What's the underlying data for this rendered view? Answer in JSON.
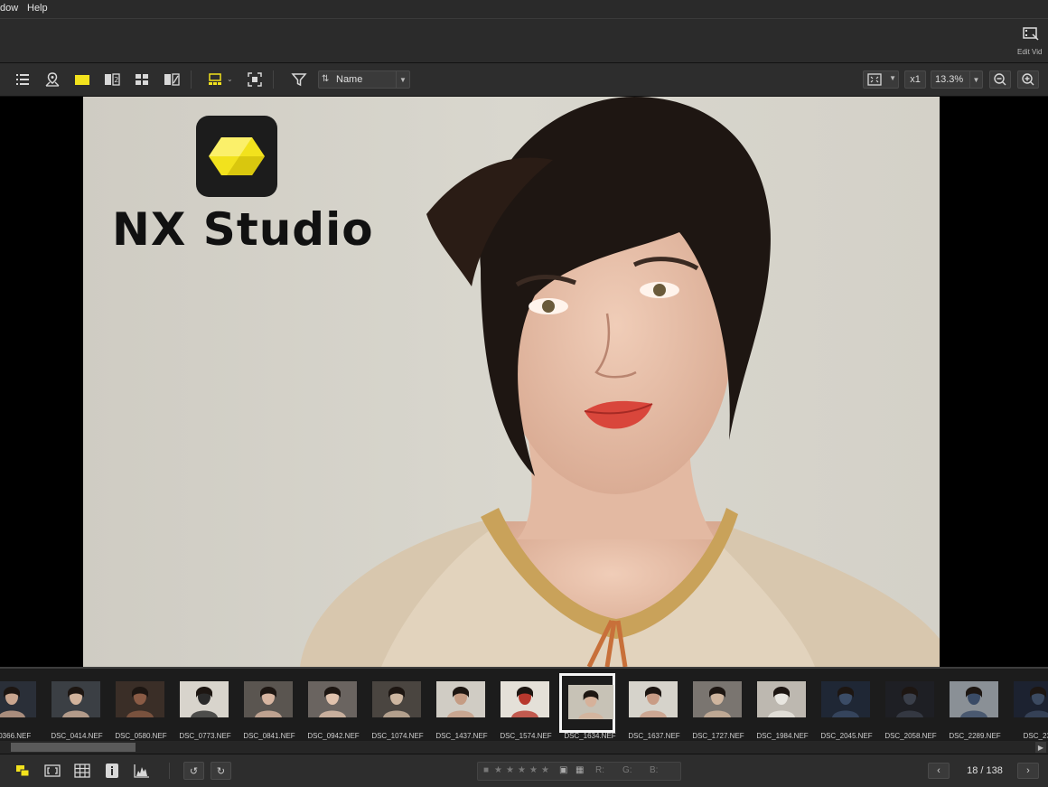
{
  "menu": {
    "items": [
      "dow",
      "Help"
    ]
  },
  "ribbon": {
    "edit_video_label": "Edit Vid"
  },
  "toolbar": {
    "sort_label": "Name",
    "zoom_x1_label": "x1",
    "zoom_value": "13.3%"
  },
  "viewer": {
    "logo_text": "NX Studio",
    "accent": "#f2e21d"
  },
  "filmstrip": {
    "thumbnails": [
      {
        "name": "_0366.NEF"
      },
      {
        "name": "DSC_0414.NEF"
      },
      {
        "name": "DSC_0580.NEF"
      },
      {
        "name": "DSC_0773.NEF"
      },
      {
        "name": "DSC_0841.NEF"
      },
      {
        "name": "DSC_0942.NEF"
      },
      {
        "name": "DSC_1074.NEF"
      },
      {
        "name": "DSC_1437.NEF"
      },
      {
        "name": "DSC_1574.NEF"
      },
      {
        "name": "DSC_1634.NEF",
        "selected": true
      },
      {
        "name": "DSC_1637.NEF"
      },
      {
        "name": "DSC_1727.NEF"
      },
      {
        "name": "DSC_1984.NEF"
      },
      {
        "name": "DSC_2045.NEF"
      },
      {
        "name": "DSC_2058.NEF"
      },
      {
        "name": "DSC_2289.NEF"
      },
      {
        "name": "DSC_232"
      }
    ]
  },
  "statusbar": {
    "rating_r": "R:",
    "rating_g": "G:",
    "rating_b": "B:",
    "counter": "18 / 138"
  }
}
